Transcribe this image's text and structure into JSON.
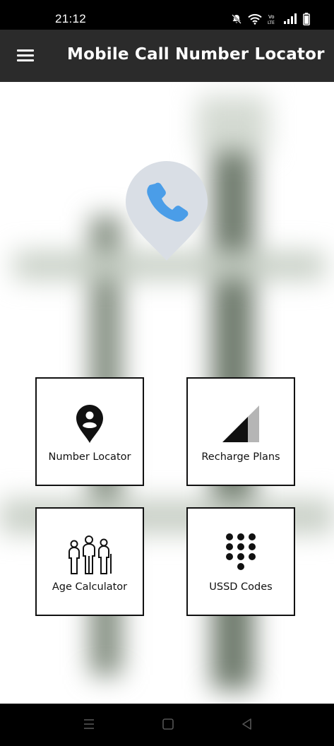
{
  "status_bar": {
    "time": "21:12",
    "icons": [
      "mute-icon",
      "wifi-icon",
      "volte-icon",
      "signal-icon",
      "battery-icon"
    ]
  },
  "app_bar": {
    "title": "Mobile Call Number Locator",
    "menu_icon": "hamburger-menu-icon"
  },
  "hero": {
    "icon": "phone-location-pin-icon",
    "colors": {
      "pin": "#d9dee5",
      "phone": "#4a9de8"
    }
  },
  "tiles": [
    {
      "label": "Number Locator",
      "icon": "location-pin-person-icon"
    },
    {
      "label": "Recharge Plans",
      "icon": "signal-strength-icon"
    },
    {
      "label": "Age Calculator",
      "icon": "family-age-icon"
    },
    {
      "label": "USSD Codes",
      "icon": "dialpad-icon"
    }
  ],
  "nav_bar": {
    "buttons": [
      "recents-icon",
      "home-icon",
      "back-icon"
    ]
  }
}
